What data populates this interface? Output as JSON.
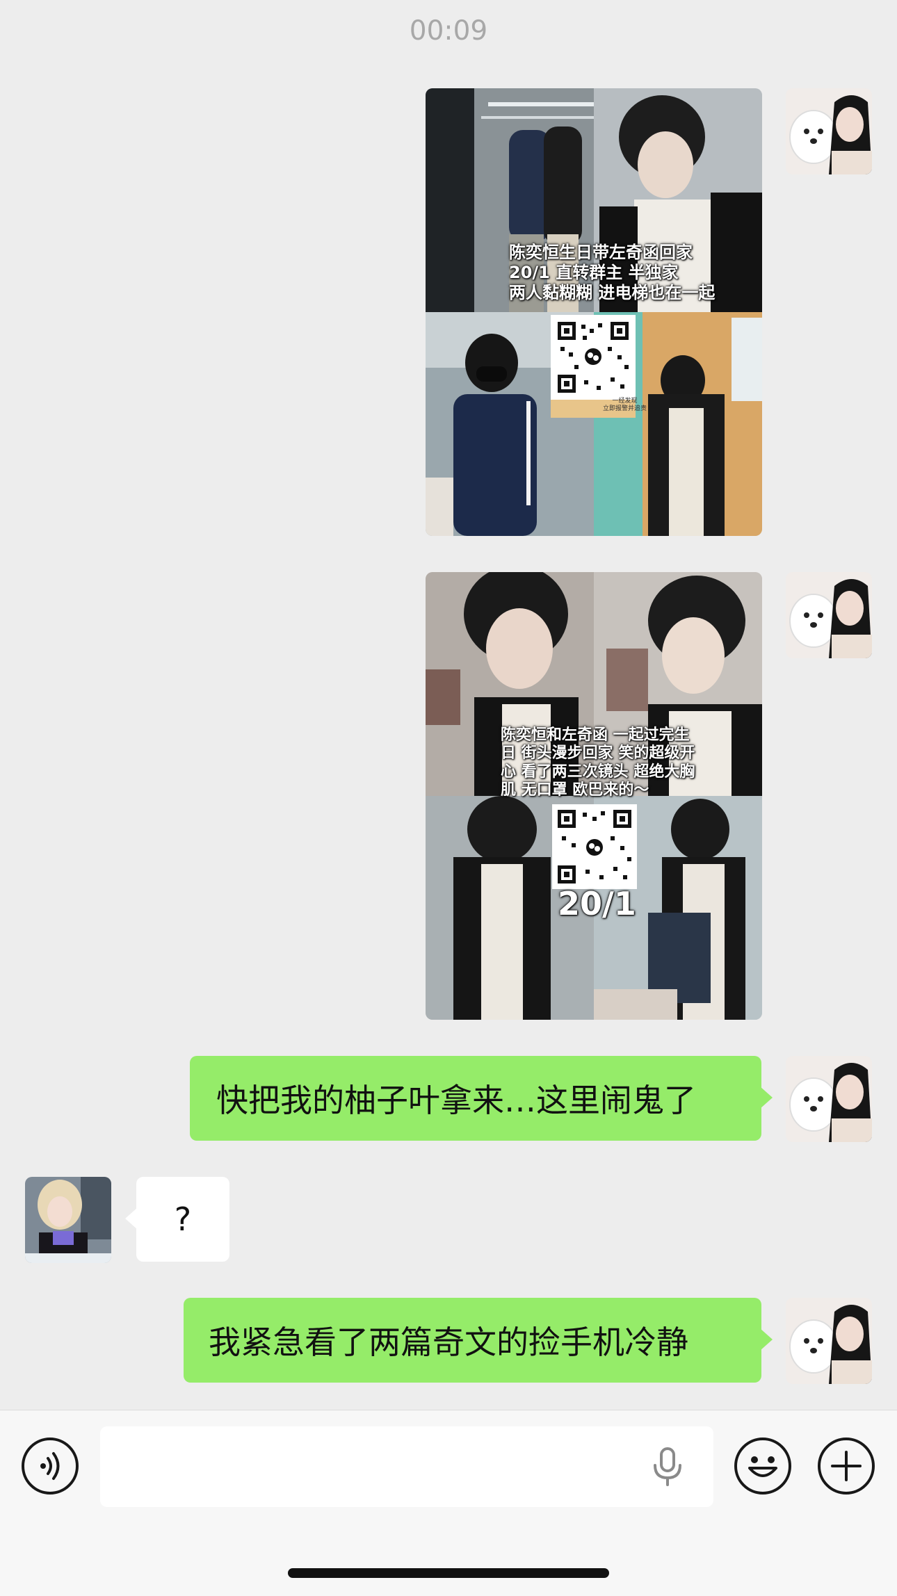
{
  "chat": {
    "timestamp": "00:09"
  },
  "messages": [
    {
      "sender": "me",
      "type": "image",
      "overlay_lines": [
        "陈奕恒生日带左奇函回家",
        "20/1 直转群主 半独家",
        "两人黏糊糊 进电梯也在一起"
      ],
      "qr_caption_lines": [
        "一经发现",
        "立即报警并追责"
      ]
    },
    {
      "sender": "me",
      "type": "image",
      "overlay_lines": [
        "陈奕恒和左奇函 一起过完生",
        "日 街头漫步回家 笑的超级开",
        "心 看了两三次镜头 超绝大胸",
        "肌 无口罩 欧巴来的～"
      ],
      "qr_price": "20/1"
    },
    {
      "sender": "me",
      "type": "text",
      "text": "快把我的柚子叶拿来…这里闹鬼了"
    },
    {
      "sender": "other",
      "type": "text",
      "text": "?"
    },
    {
      "sender": "me",
      "type": "text",
      "text": "我紧急看了两篇奇文的捡手机冷静"
    }
  ],
  "input_bar": {
    "voice_icon": "voice-icon",
    "mic_icon": "microphone-icon",
    "emoji_icon": "emoji-icon",
    "plus_icon": "plus-icon",
    "input_value": ""
  },
  "colors": {
    "background": "#ededed",
    "my_bubble": "#95ec69",
    "other_bubble": "#ffffff",
    "timestamp": "#a8a8a8"
  }
}
